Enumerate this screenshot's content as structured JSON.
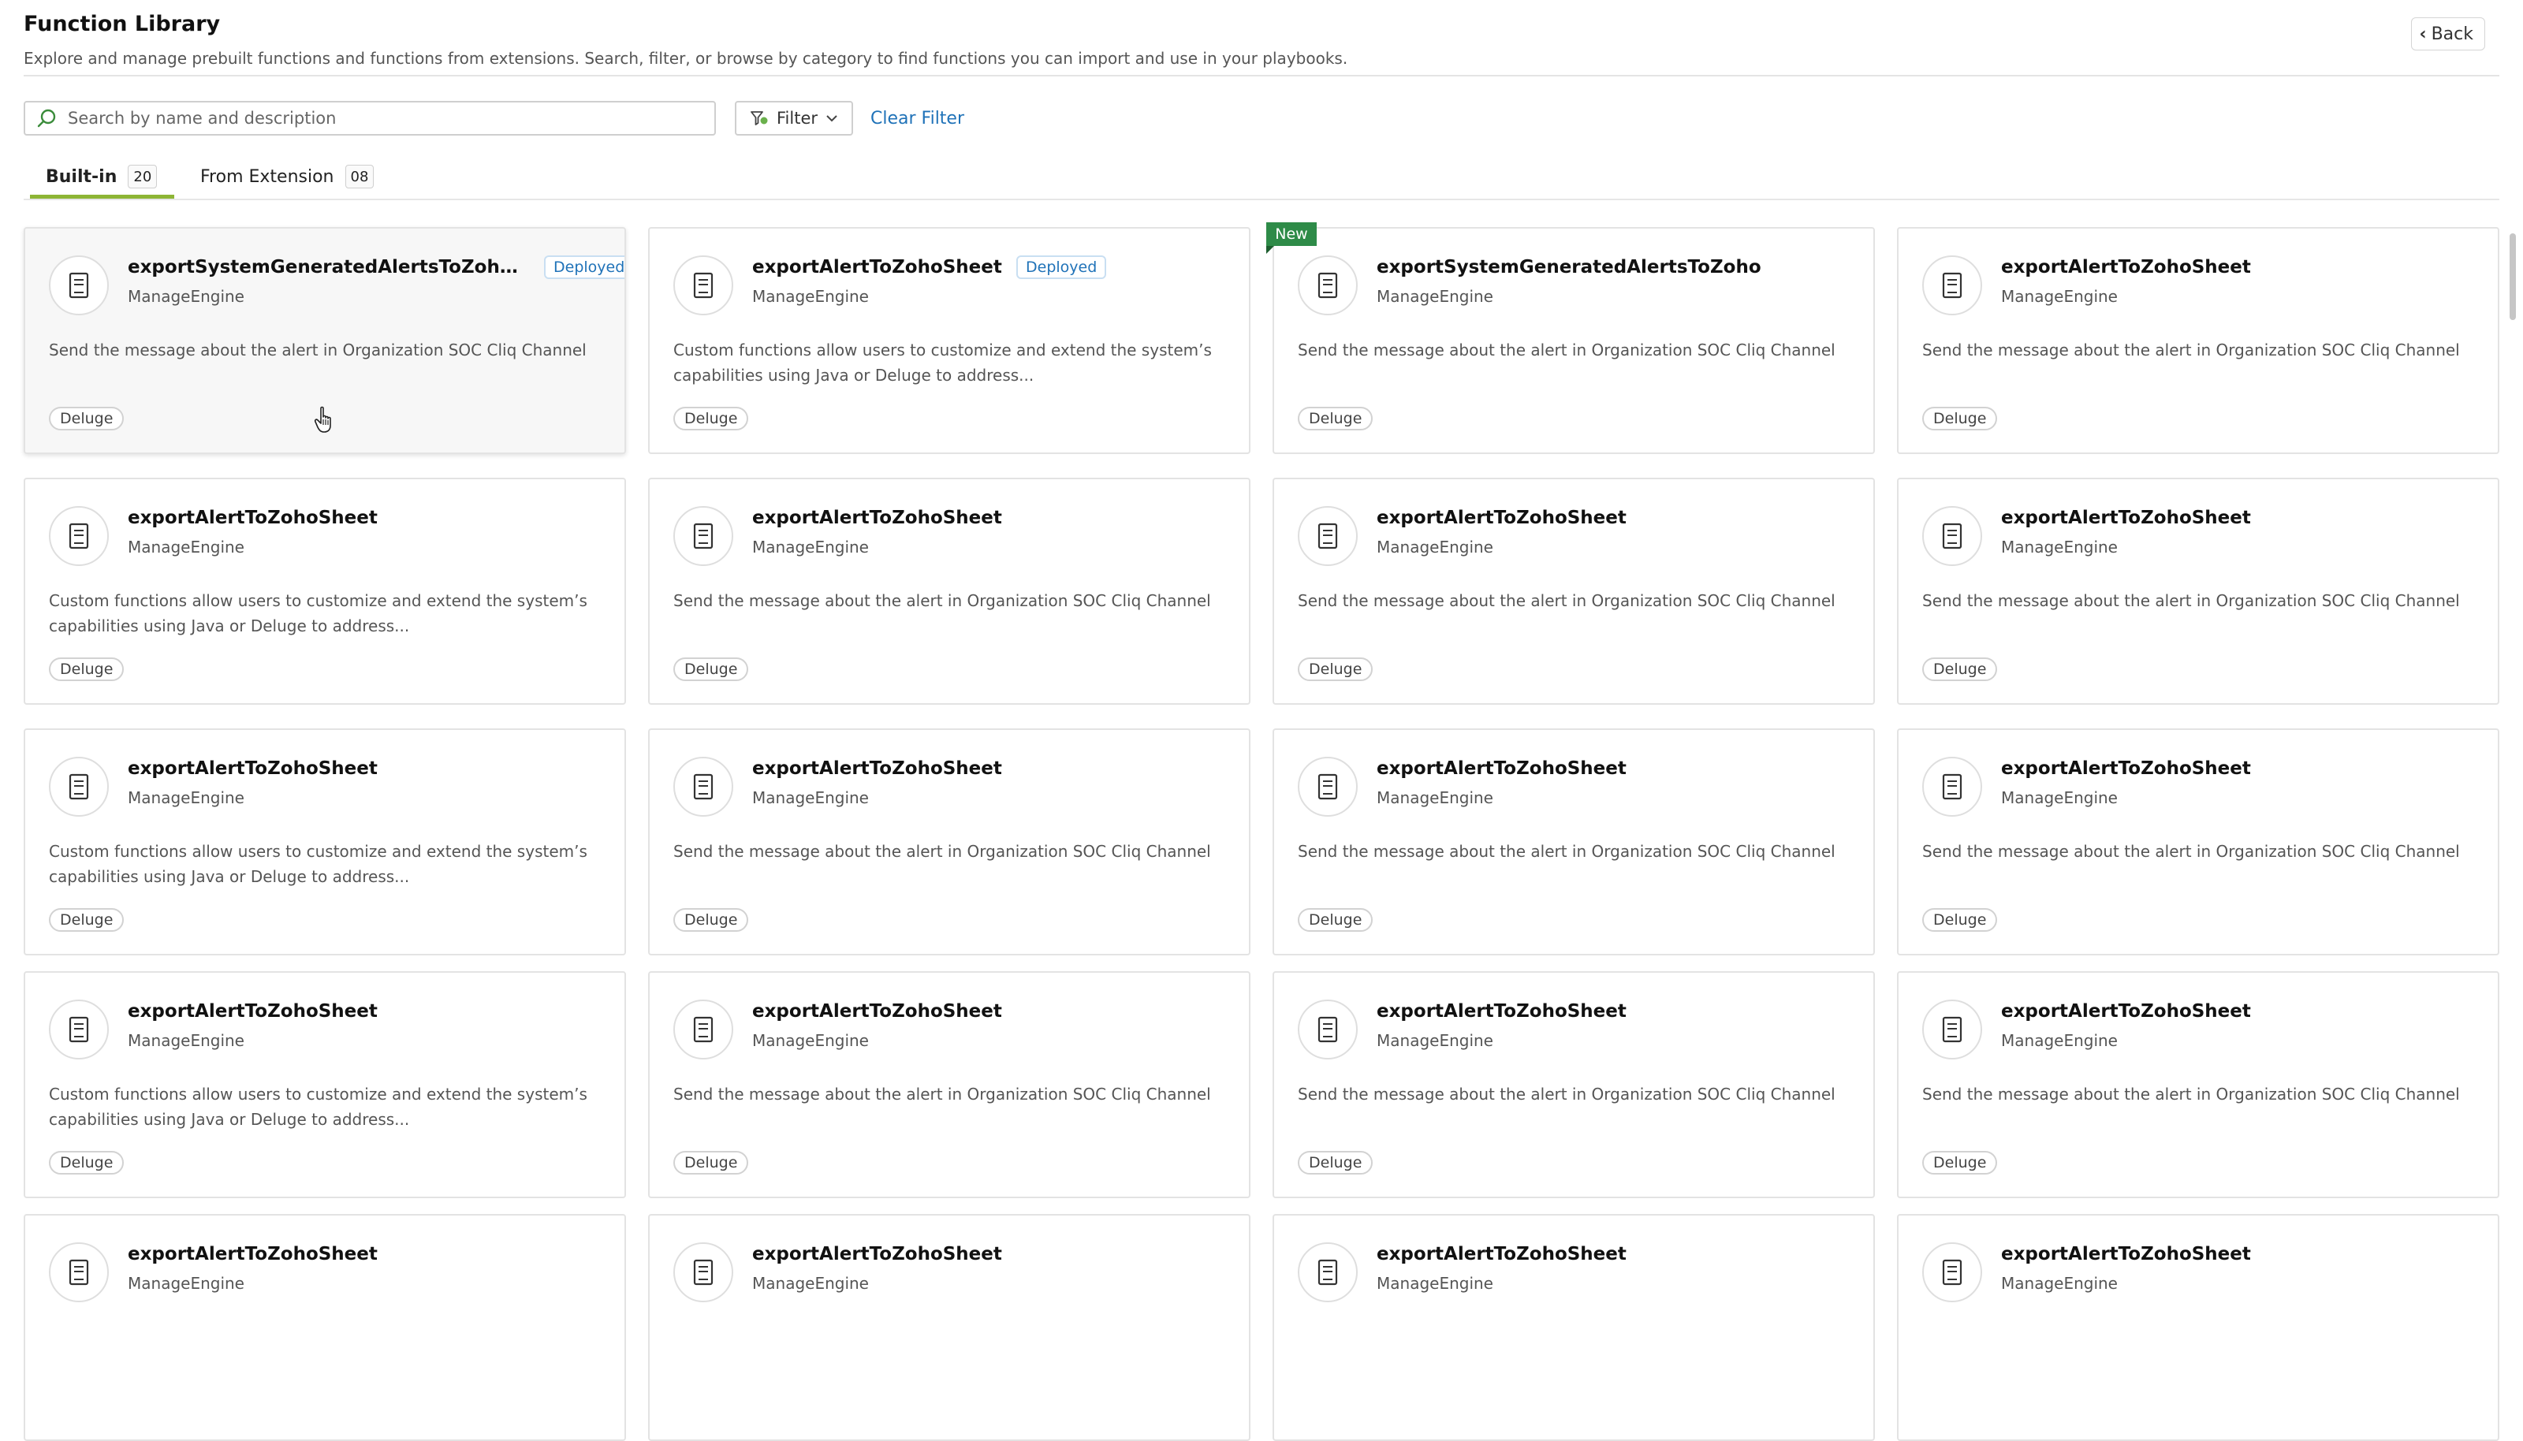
{
  "header": {
    "title": "Function Library",
    "subtitle": "Explore and manage prebuilt functions and functions from extensions. Search, filter, or browse by category to find functions you can import and use in your playbooks.",
    "back_label": "Back"
  },
  "search": {
    "placeholder": "Search by name and description",
    "value": ""
  },
  "filter": {
    "label": "Filter",
    "clear_label": "Clear Filter"
  },
  "tabs": [
    {
      "label": "Built-in",
      "count": "20",
      "active": true
    },
    {
      "label": "From Extension",
      "count": "08",
      "active": false
    }
  ],
  "colors": {
    "accent": "#8db535",
    "link": "#1f72b8",
    "new_ribbon": "#2e8b48"
  },
  "icons": {
    "card_icon": "document-icon",
    "search": "search-icon",
    "filter": "filter-icon",
    "back": "chevron-left-icon"
  },
  "cards": [
    {
      "name": "exportSystemGeneratedAlertsToZohoAna...",
      "vendor": "ManageEngine",
      "badge": "Deployed",
      "ribbon": "",
      "desc": "Send the message about the alert in Organization SOC Cliq Channel",
      "tag": "Deluge"
    },
    {
      "name": "exportAlertToZohoSheet",
      "vendor": "ManageEngine",
      "badge": "Deployed",
      "ribbon": "",
      "desc": "Custom functions allow users to customize and extend the system’s capabilities using Java or Deluge to address...",
      "tag": "Deluge"
    },
    {
      "name": "exportSystemGeneratedAlertsToZoho",
      "vendor": "ManageEngine",
      "badge": "",
      "ribbon": "New",
      "desc": "Send the message about the alert in Organization SOC Cliq Channel",
      "tag": "Deluge"
    },
    {
      "name": "exportAlertToZohoSheet",
      "vendor": "ManageEngine",
      "badge": "",
      "ribbon": "",
      "desc": "Send the message about the alert in Organization SOC Cliq Channel",
      "tag": "Deluge"
    },
    {
      "name": "exportAlertToZohoSheet",
      "vendor": "ManageEngine",
      "badge": "",
      "ribbon": "",
      "desc": "Custom functions allow users to customize and extend the system’s capabilities using Java or Deluge to address...",
      "tag": "Deluge"
    },
    {
      "name": "exportAlertToZohoSheet",
      "vendor": "ManageEngine",
      "badge": "",
      "ribbon": "",
      "desc": "Send the message about the alert in Organization SOC Cliq Channel",
      "tag": "Deluge"
    },
    {
      "name": "exportAlertToZohoSheet",
      "vendor": "ManageEngine",
      "badge": "",
      "ribbon": "",
      "desc": "Send the message about the alert in Organization SOC Cliq Channel",
      "tag": "Deluge"
    },
    {
      "name": "exportAlertToZohoSheet",
      "vendor": "ManageEngine",
      "badge": "",
      "ribbon": "",
      "desc": "Send the message about the alert in Organization SOC Cliq Channel",
      "tag": "Deluge"
    },
    {
      "name": "exportAlertToZohoSheet",
      "vendor": "ManageEngine",
      "badge": "",
      "ribbon": "",
      "desc": "Custom functions allow users to customize and extend the system’s capabilities using Java or Deluge to address...",
      "tag": "Deluge"
    },
    {
      "name": "exportAlertToZohoSheet",
      "vendor": "ManageEngine",
      "badge": "",
      "ribbon": "",
      "desc": "Send the message about the alert in Organization SOC Cliq Channel",
      "tag": "Deluge"
    },
    {
      "name": "exportAlertToZohoSheet",
      "vendor": "ManageEngine",
      "badge": "",
      "ribbon": "",
      "desc": "Send the message about the alert in Organization SOC Cliq Channel",
      "tag": "Deluge"
    },
    {
      "name": "exportAlertToZohoSheet",
      "vendor": "ManageEngine",
      "badge": "",
      "ribbon": "",
      "desc": "Send the message about the alert in Organization SOC Cliq Channel",
      "tag": "Deluge"
    },
    {
      "name": "exportAlertToZohoSheet",
      "vendor": "ManageEngine",
      "badge": "",
      "ribbon": "",
      "desc": "Custom functions allow users to customize and extend the system’s capabilities using Java or Deluge to address...",
      "tag": "Deluge"
    },
    {
      "name": "exportAlertToZohoSheet",
      "vendor": "ManageEngine",
      "badge": "",
      "ribbon": "",
      "desc": "Send the message about the alert in Organization SOC Cliq Channel",
      "tag": "Deluge"
    },
    {
      "name": "exportAlertToZohoSheet",
      "vendor": "ManageEngine",
      "badge": "",
      "ribbon": "",
      "desc": "Send the message about the alert in Organization SOC Cliq Channel",
      "tag": "Deluge"
    },
    {
      "name": "exportAlertToZohoSheet",
      "vendor": "ManageEngine",
      "badge": "",
      "ribbon": "",
      "desc": "Send the message about the alert in Organization SOC Cliq Channel",
      "tag": "Deluge"
    },
    {
      "name": "exportAlertToZohoSheet",
      "vendor": "ManageEngine",
      "badge": "",
      "ribbon": "",
      "desc": "",
      "tag": ""
    },
    {
      "name": "exportAlertToZohoSheet",
      "vendor": "ManageEngine",
      "badge": "",
      "ribbon": "",
      "desc": "",
      "tag": ""
    },
    {
      "name": "exportAlertToZohoSheet",
      "vendor": "ManageEngine",
      "badge": "",
      "ribbon": "",
      "desc": "",
      "tag": ""
    },
    {
      "name": "exportAlertToZohoSheet",
      "vendor": "ManageEngine",
      "badge": "",
      "ribbon": "",
      "desc": "",
      "tag": ""
    }
  ]
}
